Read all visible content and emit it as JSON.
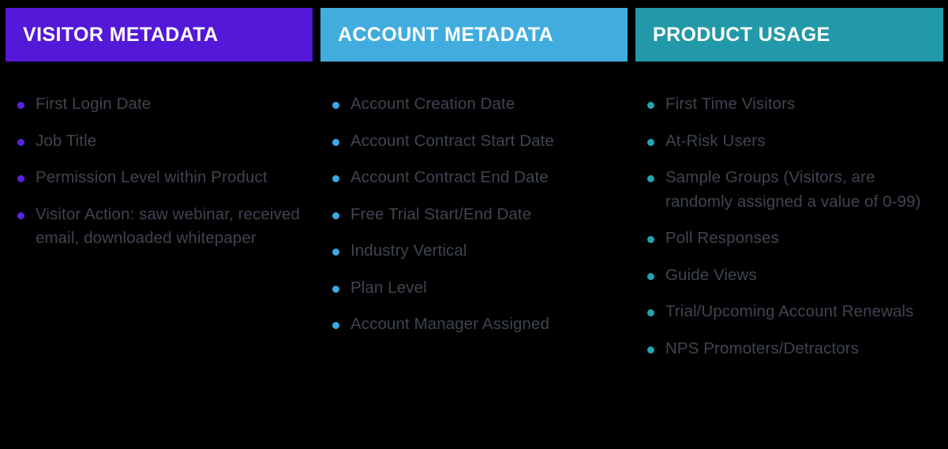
{
  "background_color": "#000000",
  "text_color": "#3f4450",
  "columns": [
    {
      "id": "visitor-metadata",
      "header": "VISITOR METADATA",
      "header_bg": "#5418d8",
      "bullet_color": "#5b21e0",
      "items": [
        "First Login Date",
        "Job Title",
        "Permission Level within Product",
        "Visitor Action: saw webinar, received email, downloaded whitepaper"
      ]
    },
    {
      "id": "account-metadata",
      "header": "ACCOUNT METADATA",
      "header_bg": "#41addf",
      "bullet_color": "#3aa9e5",
      "items": [
        "Account Creation Date",
        "Account Contract Start Date",
        "Account Contract End Date",
        "Free Trial Start/End Date",
        "Industry Vertical",
        "Plan Level",
        "Account Manager Assigned"
      ]
    },
    {
      "id": "product-usage",
      "header": "PRODUCT USAGE",
      "header_bg": "#2299a8",
      "bullet_color": "#24a3b0",
      "items": [
        "First Time Visitors",
        "At-Risk Users",
        "Sample Groups (Visitors, are randomly assigned a value of 0-99)",
        "Poll Responses",
        "Guide Views",
        "Trial/Upcoming Account Renewals",
        "NPS Promoters/Detractors"
      ]
    }
  ]
}
